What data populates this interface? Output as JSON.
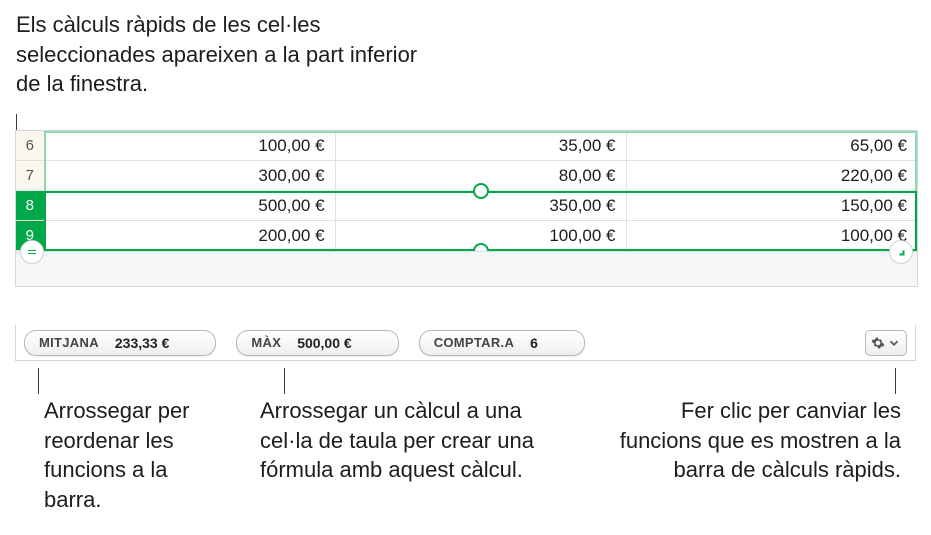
{
  "callouts": {
    "top": "Els càlculs ràpids de les cel·les seleccionades apareixen a la part inferior de la finestra.",
    "reorder": "Arrossegar per reordenar les funcions a la barra.",
    "drag_cell": "Arrossegar un càlcul a una cel·la de taula per crear una fórmula amb aquest càlcul.",
    "gear": "Fer clic per canviar les funcions que es mostren a la barra de càlculs ràpids."
  },
  "table": {
    "rows": [
      {
        "hdr": "6",
        "selected": false,
        "cells": [
          "100,00 €",
          "35,00 €",
          "65,00 €"
        ]
      },
      {
        "hdr": "7",
        "selected": false,
        "cells": [
          "300,00 €",
          "80,00 €",
          "220,00 €"
        ]
      },
      {
        "hdr": "8",
        "selected": true,
        "cells": [
          "500,00 €",
          "350,00 €",
          "150,00 €"
        ]
      },
      {
        "hdr": "9",
        "selected": true,
        "cells": [
          "200,00 €",
          "100,00 €",
          "100,00 €"
        ]
      }
    ]
  },
  "quick_calc": {
    "items": [
      {
        "label": "MITJANA",
        "value": "233,33 €"
      },
      {
        "label": "MÀX",
        "value": "500,00 €"
      },
      {
        "label": "COMPTAR.A",
        "value": "6"
      }
    ]
  },
  "icons": {
    "equals": "=",
    "resize": "⌐"
  }
}
